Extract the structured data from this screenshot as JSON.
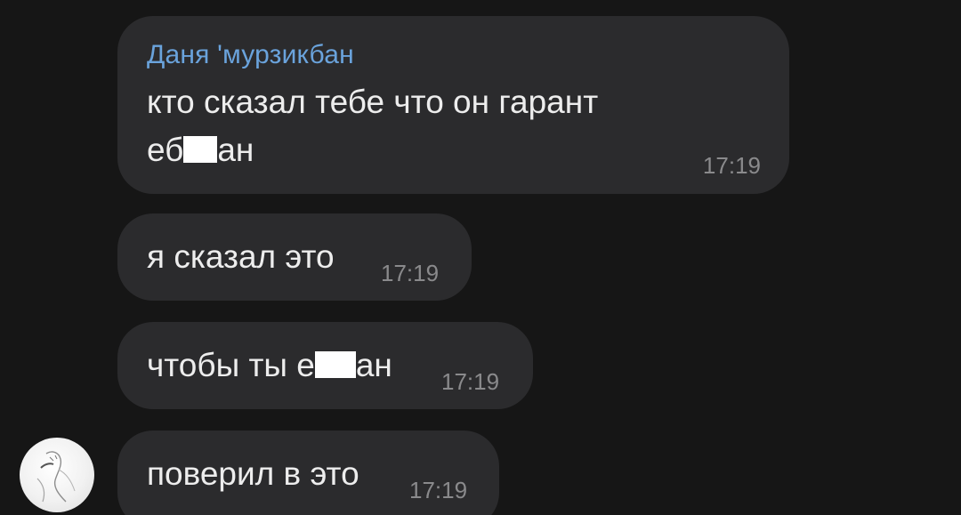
{
  "messages": [
    {
      "sender": "Даня 'мурзикбан",
      "line1": "кто сказал тебе что он гарант",
      "line2_before": "еб",
      "line2_after": "ан",
      "time": "17:19"
    },
    {
      "text": "я сказал это",
      "time": "17:19"
    },
    {
      "text_before": "чтобы ты е",
      "text_after": "ан",
      "time": "17:19"
    },
    {
      "text": "поверил в это",
      "time": "17:19"
    }
  ],
  "colors": {
    "background": "#161616",
    "bubble": "#2b2b2d",
    "sender_name": "#6aa3dc",
    "text": "#ededed",
    "timestamp": "#8a8a8c",
    "censor_box": "#ffffff"
  },
  "avatar": {
    "icon": "user-avatar"
  }
}
